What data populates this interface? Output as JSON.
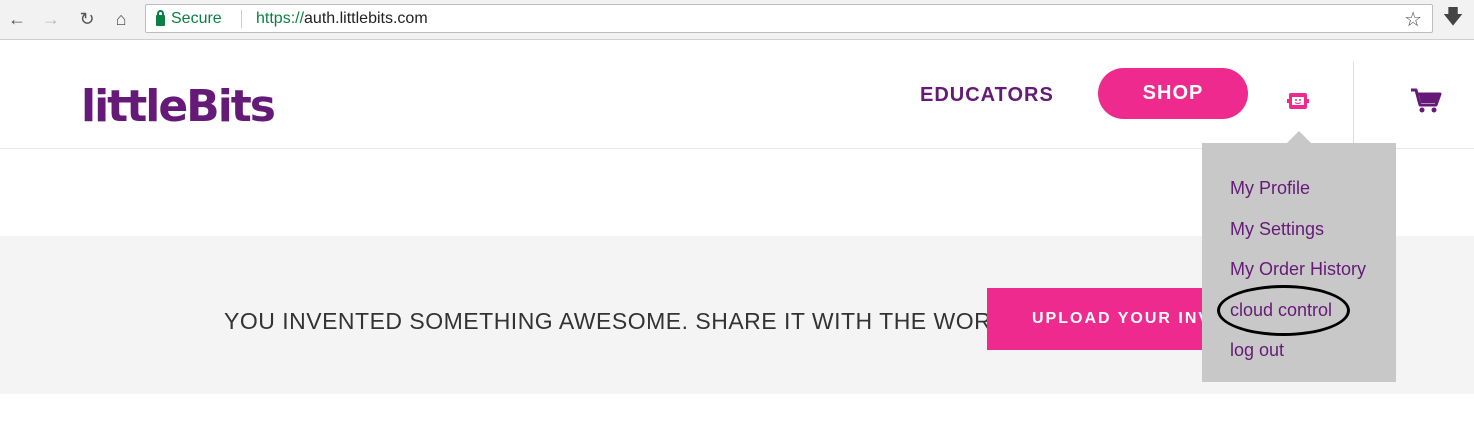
{
  "browser": {
    "secure_label": "Secure",
    "url_scheme": "https://",
    "url_host": "auth.littlebits.com"
  },
  "header": {
    "logo_text": "littleBits",
    "logo_tm": "™",
    "educators_label": "EDUCATORS",
    "shop_label": "SHOP"
  },
  "banner": {
    "text": "YOU INVENTED SOMETHING AWESOME. SHARE IT WITH THE WORLD!",
    "upload_label": "UPLOAD YOUR INV"
  },
  "dropdown": {
    "items": [
      {
        "label": "My Profile"
      },
      {
        "label": "My Settings"
      },
      {
        "label": "My Order History"
      },
      {
        "label": "cloud control"
      },
      {
        "label": "log out"
      }
    ]
  },
  "colors": {
    "brand_purple": "#651a77",
    "brand_pink": "#ee2a8e",
    "secure_green": "#0b8043",
    "dropdown_bg": "#c8c8c8"
  },
  "icons": [
    "back-arrow-icon",
    "forward-arrow-icon",
    "reload-icon",
    "home-icon",
    "lock-icon",
    "star-icon",
    "download-icon",
    "user-icon",
    "cart-icon"
  ]
}
